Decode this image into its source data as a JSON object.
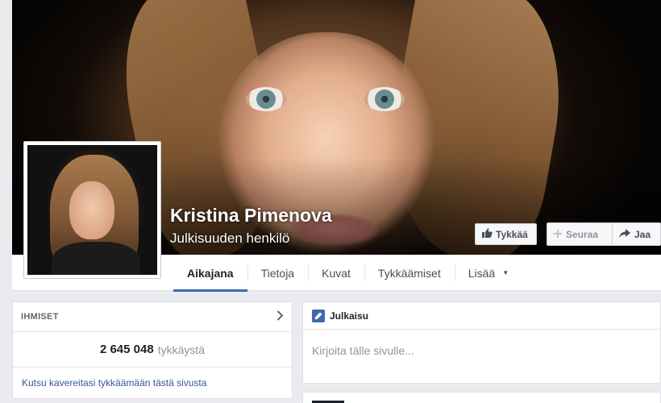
{
  "profile": {
    "name": "Kristina Pimenova",
    "category": "Julkisuuden henkilö"
  },
  "actions": {
    "like_label": "Tykkää",
    "follow_label": "Seuraa",
    "share_label": "Jaa"
  },
  "tabs": [
    {
      "label": "Aikajana",
      "active": true
    },
    {
      "label": "Tietoja",
      "active": false
    },
    {
      "label": "Kuvat",
      "active": false
    },
    {
      "label": "Tykkäämiset",
      "active": false
    },
    {
      "label": "Lisää",
      "active": false
    }
  ],
  "people": {
    "title": "IHMISET",
    "likes_count": "2 645 048",
    "likes_label": "tykkäystä",
    "invite_text": "Kutsu kavereitasi tykkäämään tästä sivusta"
  },
  "composer": {
    "title": "Julkaisu",
    "placeholder": "Kirjoita tälle sivulle..."
  },
  "colors": {
    "accent": "#4267b2",
    "link": "#365899",
    "background": "#e9ebee"
  },
  "icons": {
    "like": "thumbs-up-icon",
    "follow": "plus-icon",
    "share": "share-arrow-icon",
    "more": "caret-down-icon",
    "people_more": "chevron-right-icon",
    "post": "pencil-icon"
  }
}
